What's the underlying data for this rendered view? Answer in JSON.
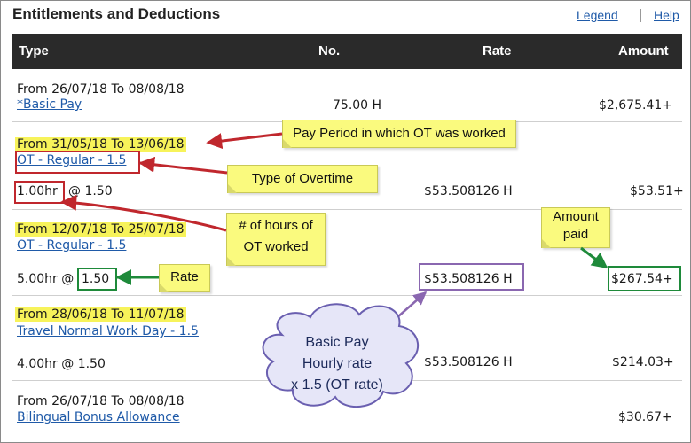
{
  "title": "Entitlements and Deductions",
  "links": {
    "legend": "Legend",
    "help": "Help"
  },
  "columns": {
    "type": "Type",
    "no": "No.",
    "rate": "Rate",
    "amount": "Amount"
  },
  "rows": [
    {
      "period": "From 26/07/18 To 08/08/18",
      "item": "*Basic Pay",
      "detail": "",
      "no": "75.00 H",
      "rate": "",
      "amount": "$2,675.41+"
    },
    {
      "period": "From 31/05/18 To 13/06/18",
      "item": "OT - Regular - 1.5",
      "detail_hours": "1.00hr",
      "detail_at": "@ 1.50",
      "no": "",
      "rate": "$53.508126 H",
      "amount": "$53.51+"
    },
    {
      "period": "From 12/07/18 To 25/07/18",
      "item": "OT - Regular - 1.5",
      "detail_hours": "5.00hr @",
      "detail_at": "1.50",
      "no": "",
      "rate": "$53.508126 H",
      "amount": "$267.54+"
    },
    {
      "period": "From 28/06/18 To 11/07/18",
      "item": "Travel Normal Work Day - 1.5",
      "detail_hours": "4.00hr @ 1.50",
      "no": "",
      "rate": "$53.508126 H",
      "amount": "$214.03+"
    },
    {
      "period": "From 26/07/18 To 08/08/18",
      "item": "Bilingual Bonus Allowance",
      "no": "",
      "rate": "",
      "amount": "$30.67+"
    }
  ],
  "annotations": {
    "pay_period": "Pay Period in which OT was worked",
    "type_of_ot": "Type of Overtime",
    "hours_line1": "# of hours of",
    "hours_line2": "OT worked",
    "rate": "Rate",
    "amount_line1": "Amount",
    "amount_line2": "paid",
    "cloud_line1": "Basic Pay",
    "cloud_line2": "Hourly rate",
    "cloud_line3": "x 1.5 (OT rate)"
  },
  "colors": {
    "highlight": "#f7f35a",
    "red_arrow": "#c0272d",
    "green_box": "#1e8a3a",
    "purple_box": "#8a67b0",
    "note": "#fafa7e",
    "link": "#1f5aa8"
  }
}
